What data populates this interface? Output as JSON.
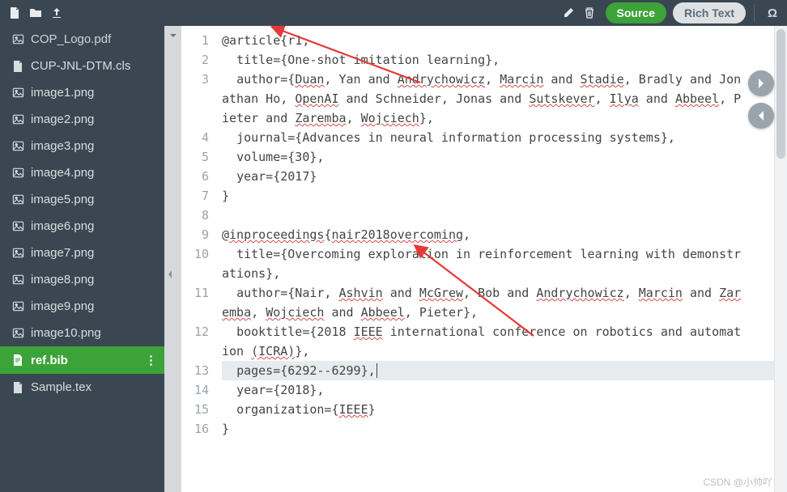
{
  "toolbar": {
    "source_label": "Source",
    "rich_label": "Rich Text"
  },
  "sidebar": {
    "files": [
      {
        "name": "COP_Logo.pdf",
        "icon": "image",
        "truncated": true
      },
      {
        "name": "CUP-JNL-DTM.cls",
        "icon": "file"
      },
      {
        "name": "image1.png",
        "icon": "image"
      },
      {
        "name": "image2.png",
        "icon": "image"
      },
      {
        "name": "image3.png",
        "icon": "image"
      },
      {
        "name": "image4.png",
        "icon": "image"
      },
      {
        "name": "image5.png",
        "icon": "image"
      },
      {
        "name": "image6.png",
        "icon": "image"
      },
      {
        "name": "image7.png",
        "icon": "image"
      },
      {
        "name": "image8.png",
        "icon": "image"
      },
      {
        "name": "image9.png",
        "icon": "image"
      },
      {
        "name": "image10.png",
        "icon": "image"
      },
      {
        "name": "ref.bib",
        "icon": "file-list",
        "active": true
      },
      {
        "name": "Sample.tex",
        "icon": "file"
      }
    ]
  },
  "editor": {
    "lines": [
      {
        "num": 1,
        "content": "@article{r1,"
      },
      {
        "num": 2,
        "content": "  title={One-shot imitation learning},"
      },
      {
        "num": 3,
        "content": "  author={Duan, Yan and Andrychowicz, Marcin and Stadie, Bradly and Jonathan Ho, OpenAI and Schneider, Jonas and Sutskever, Ilya and Abbeel, Pieter and Zaremba, Wojciech},",
        "wrap": 3
      },
      {
        "num": 4,
        "content": "  journal={Advances in neural information processing systems},"
      },
      {
        "num": 5,
        "content": "  volume={30},"
      },
      {
        "num": 6,
        "content": "  year={2017}"
      },
      {
        "num": 7,
        "content": "}"
      },
      {
        "num": 8,
        "content": ""
      },
      {
        "num": 9,
        "content": "@inproceedings{nair2018overcoming,"
      },
      {
        "num": 10,
        "content": "  title={Overcoming exploration in reinforcement learning with demonstrations},",
        "wrap": 2
      },
      {
        "num": 11,
        "content": "  author={Nair, Ashvin and McGrew, Bob and Andrychowicz, Marcin and Zaremba, Wojciech and Abbeel, Pieter},",
        "wrap": 2
      },
      {
        "num": 12,
        "content": "  booktitle={2018 IEEE international conference on robotics and automation (ICRA)},",
        "wrap": 2
      },
      {
        "num": 13,
        "content": "  pages={6292--6299},",
        "cursor": true
      },
      {
        "num": 14,
        "content": "  year={2018},"
      },
      {
        "num": 15,
        "content": "  organization={IEEE}"
      },
      {
        "num": 16,
        "content": "}"
      }
    ],
    "spellcheck_words": [
      "Duan",
      "Andrychowicz",
      "Marcin",
      "Stadie",
      "OpenAI",
      "Sutskever",
      "Ilya",
      "Abbeel",
      "Zaremba",
      "Wojciech",
      "inproceedings",
      "nair2018overcoming",
      "Ashvin",
      "McGrew",
      "ICRA",
      "IEEE"
    ]
  },
  "watermark": "CSDN @小帅吖"
}
